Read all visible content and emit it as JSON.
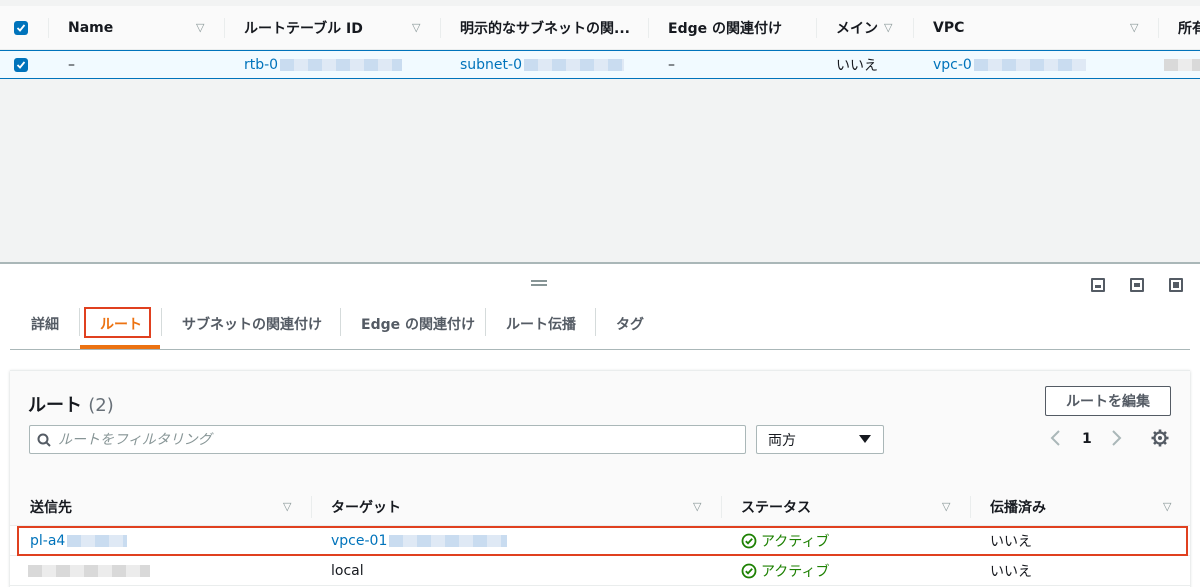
{
  "top_table": {
    "columns": [
      "Name",
      "ルートテーブル ID",
      "明示的なサブネットの関...",
      "Edge の関連付け",
      "メイン",
      "VPC",
      "所有"
    ],
    "row": {
      "name": "–",
      "route_table_id": "rtb-0",
      "subnet": "subnet-0",
      "edge": "–",
      "main": "いいえ",
      "vpc": "vpc-0"
    }
  },
  "tabs": [
    "詳細",
    "ルート",
    "サブネットの関連付け",
    "Edge の関連付け",
    "ルート伝播",
    "タグ"
  ],
  "routes": {
    "title": "ルート",
    "count": "(2)",
    "edit_button": "ルートを編集",
    "search_placeholder": "ルートをフィルタリング",
    "filter_select": "両方",
    "page": "1",
    "columns": [
      "送信先",
      "ターゲット",
      "ステータス",
      "伝播済み"
    ],
    "rows": [
      {
        "destination": "pl-a4",
        "target": "vpce-01",
        "status": "アクティブ",
        "propagated": "いいえ"
      },
      {
        "destination": "",
        "target": "local",
        "status": "アクティブ",
        "propagated": "いいえ"
      }
    ]
  },
  "colors": {
    "accent": "#0073bb",
    "active_tab": "#ec7211",
    "highlight": "#e0401f",
    "status_ok": "#1d8102"
  }
}
